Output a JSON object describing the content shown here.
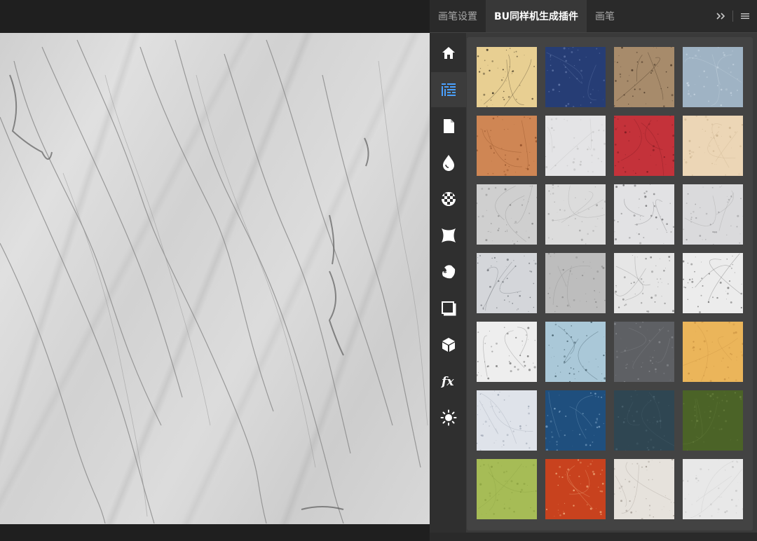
{
  "tabs": [
    {
      "label": "画笔设置",
      "active": false
    },
    {
      "label": "BU同样机生成插件",
      "active": true
    },
    {
      "label": "画笔",
      "active": false
    }
  ],
  "controls": {
    "expand_icon": "double-chevron-right-icon",
    "menu_icon": "hamburger-menu-icon"
  },
  "sidebar": {
    "items": [
      {
        "name": "home-icon",
        "active": false
      },
      {
        "name": "texture-grid-icon",
        "active": true
      },
      {
        "name": "document-icon",
        "active": false
      },
      {
        "name": "drop-icon",
        "active": false
      },
      {
        "name": "checker-pattern-icon",
        "active": false
      },
      {
        "name": "warp-shape-icon",
        "active": false
      },
      {
        "name": "paper-curl-icon",
        "active": false
      },
      {
        "name": "shadow-square-icon",
        "active": false
      },
      {
        "name": "cube-icon",
        "active": false
      },
      {
        "name": "fx-icon",
        "active": false
      },
      {
        "name": "sun-icon",
        "active": false
      }
    ],
    "accent": "#4aa0ff"
  },
  "textures": [
    {
      "row": 0,
      "col": 0,
      "color": "#e8cf92",
      "speck": "#3a3020"
    },
    {
      "row": 0,
      "col": 1,
      "color": "#263d75",
      "speck": "#6a7fb0"
    },
    {
      "row": 0,
      "col": 2,
      "color": "#a78b6b",
      "speck": "#3a2a1c"
    },
    {
      "row": 0,
      "col": 3,
      "color": "#9fb3c4",
      "speck": "#c8d6e2"
    },
    {
      "row": 1,
      "col": 0,
      "color": "#cf8654",
      "speck": "#8a4a24"
    },
    {
      "row": 1,
      "col": 1,
      "color": "#e4e4e6",
      "speck": "#bdbdbd"
    },
    {
      "row": 1,
      "col": 2,
      "color": "#c4323a",
      "speck": "#7a1a20"
    },
    {
      "row": 1,
      "col": 3,
      "color": "#ecd6b6",
      "speck": "#c9b08c"
    },
    {
      "row": 2,
      "col": 0,
      "color": "#cfcfcf",
      "speck": "#8a8a8a"
    },
    {
      "row": 2,
      "col": 1,
      "color": "#dcdcdc",
      "speck": "#a0a0a0"
    },
    {
      "row": 2,
      "col": 2,
      "color": "#e2e2e4",
      "speck": "#6e6e70"
    },
    {
      "row": 2,
      "col": 3,
      "color": "#dadadc",
      "speck": "#9a9a9c"
    },
    {
      "row": 3,
      "col": 0,
      "color": "#d4d6da",
      "speck": "#6a6e74"
    },
    {
      "row": 3,
      "col": 1,
      "color": "#bdbdbd",
      "speck": "#8c8c8c"
    },
    {
      "row": 3,
      "col": 2,
      "color": "#e6e6e6",
      "speck": "#808080"
    },
    {
      "row": 3,
      "col": 3,
      "color": "#ececec",
      "speck": "#5a5a5a"
    },
    {
      "row": 4,
      "col": 0,
      "color": "#eeeeee",
      "speck": "#707070"
    },
    {
      "row": 4,
      "col": 1,
      "color": "#aac8d8",
      "speck": "#36505c"
    },
    {
      "row": 4,
      "col": 2,
      "color": "#5e6064",
      "speck": "#8a8c90"
    },
    {
      "row": 4,
      "col": 3,
      "color": "#ebb55a",
      "speck": "#c89040"
    },
    {
      "row": 5,
      "col": 0,
      "color": "#dfe3ea",
      "speck": "#9aa2b0"
    },
    {
      "row": 5,
      "col": 1,
      "color": "#1f4f7e",
      "speck": "#7ea4c6"
    },
    {
      "row": 5,
      "col": 2,
      "color": "#2f4652",
      "speck": "#4b6470"
    },
    {
      "row": 5,
      "col": 3,
      "color": "#4b6327",
      "speck": "#6a8240"
    },
    {
      "row": 6,
      "col": 0,
      "color": "#a6bc56",
      "speck": "#8aa040"
    },
    {
      "row": 6,
      "col": 1,
      "color": "#c8421e",
      "speck": "#f0b080"
    },
    {
      "row": 6,
      "col": 2,
      "color": "#e6e2dc",
      "speck": "#a09890"
    },
    {
      "row": 6,
      "col": 3,
      "color": "#e8e8e8",
      "speck": "#c4c4c4"
    }
  ]
}
